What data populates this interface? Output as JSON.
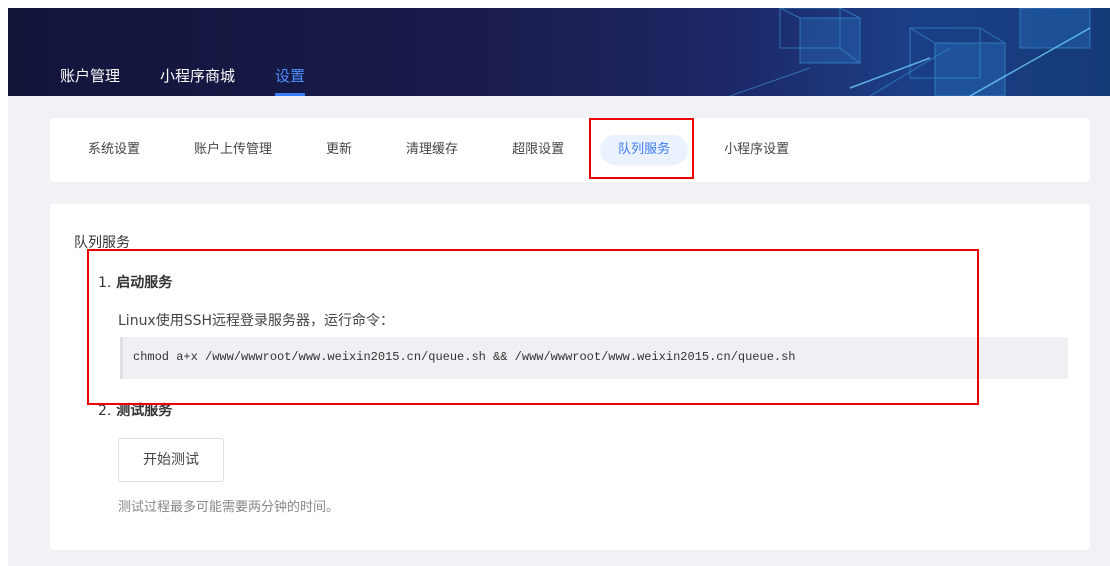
{
  "top_nav": {
    "tabs": [
      {
        "label": "账户管理",
        "active": false
      },
      {
        "label": "小程序商城",
        "active": false
      },
      {
        "label": "设置",
        "active": true
      }
    ]
  },
  "sub_nav": {
    "tabs": [
      {
        "label": "系统设置",
        "active": false
      },
      {
        "label": "账户上传管理",
        "active": false
      },
      {
        "label": "更新",
        "active": false
      },
      {
        "label": "清理缓存",
        "active": false
      },
      {
        "label": "超限设置",
        "active": false
      },
      {
        "label": "队列服务",
        "active": true
      },
      {
        "label": "小程序设置",
        "active": false
      }
    ]
  },
  "content": {
    "section_title": "队列服务",
    "step1": {
      "number": "1.",
      "title": "启动服务",
      "description": "Linux使用SSH远程登录服务器，运行命令：",
      "command": "chmod a+x /www/wwwroot/www.weixin2015.cn/queue.sh && /www/wwwroot/www.weixin2015.cn/queue.sh"
    },
    "step2": {
      "number": "2.",
      "title": "测试服务",
      "button_label": "开始测试",
      "hint": "测试过程最多可能需要两分钟的时间。"
    }
  },
  "colors": {
    "accent": "#3e7bf5",
    "highlight_box": "#ee0000",
    "header_bg": "#1a1d4d"
  }
}
